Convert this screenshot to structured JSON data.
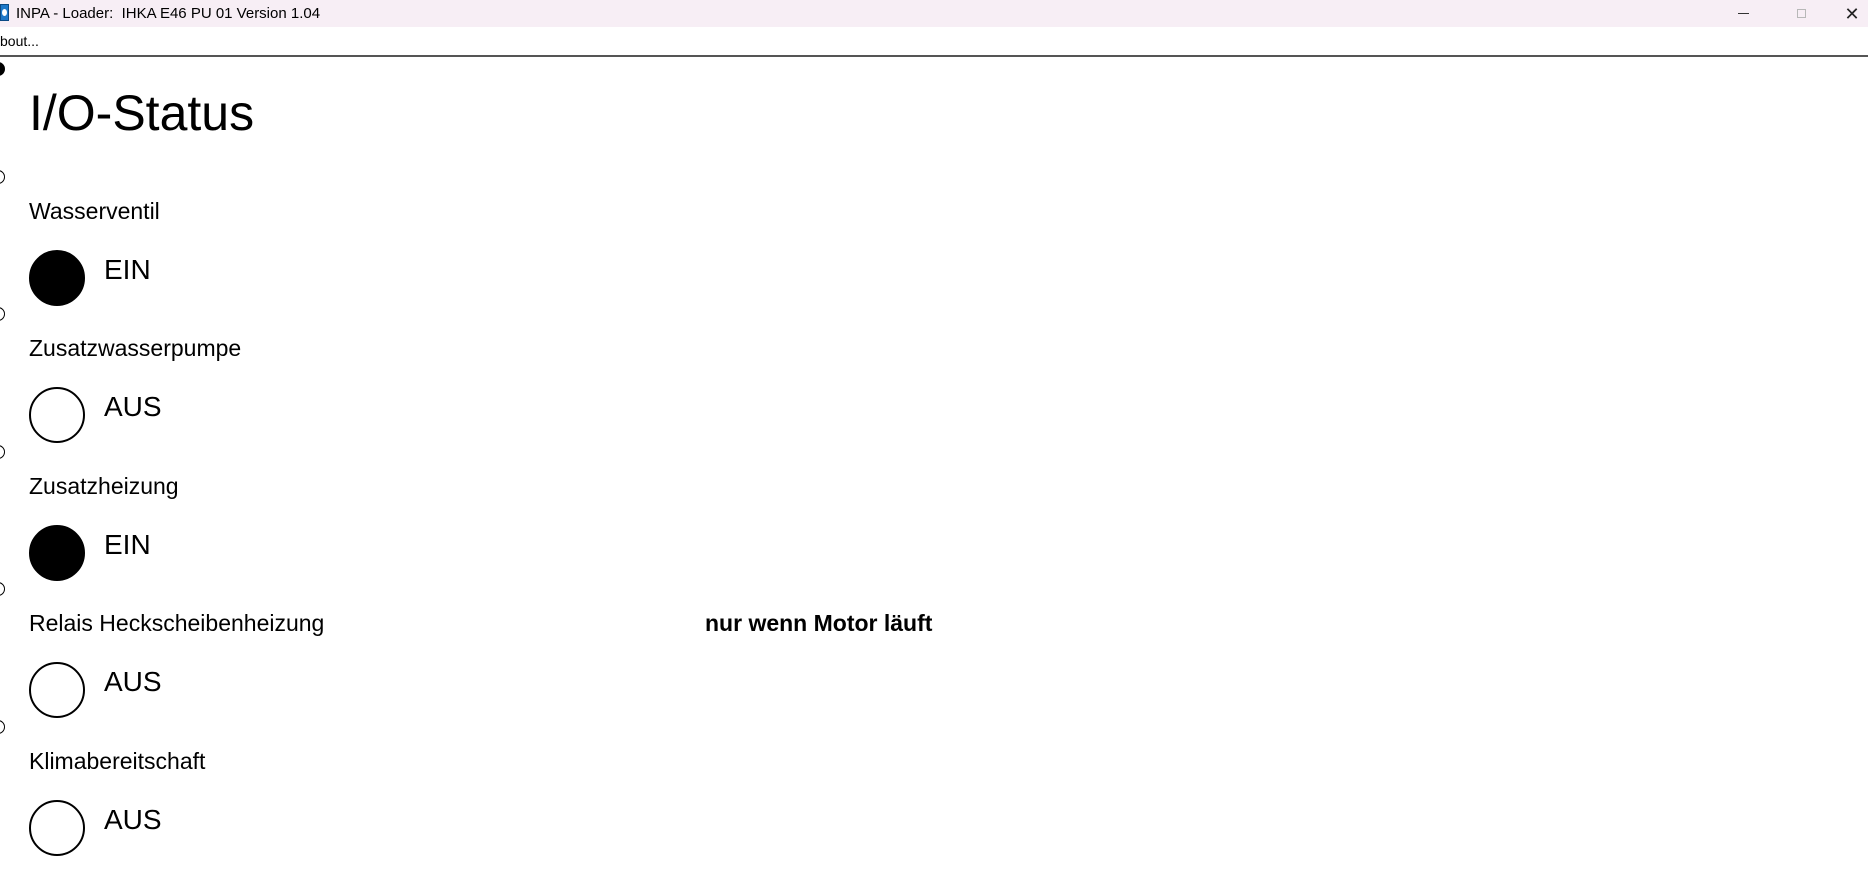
{
  "window": {
    "title": "INPA - Loader:  IHKA E46 PU 01 Version 1.04",
    "minimize_icon": "minimize-icon",
    "maximize_icon": "maximize-icon",
    "close_icon": "close-icon",
    "close_glyph": "✕"
  },
  "menu": {
    "about": "bout..."
  },
  "page": {
    "title": "I/O-Status"
  },
  "screen_selector": {
    "selected_index": 0,
    "count": 6
  },
  "io_items": [
    {
      "label": "Wasserventil",
      "state": "on",
      "value": "EIN",
      "note": ""
    },
    {
      "label": "Zusatzwasserpumpe",
      "state": "off",
      "value": "AUS",
      "note": ""
    },
    {
      "label": "Zusatzheizung",
      "state": "on",
      "value": "EIN",
      "note": ""
    },
    {
      "label": "Relais Heckscheibenheizung",
      "state": "off",
      "value": "AUS",
      "note": "nur wenn Motor läuft"
    },
    {
      "label": "Klimabereitschaft",
      "state": "off",
      "value": "AUS",
      "note": ""
    }
  ],
  "colors": {
    "titlebar_bg": "#f7eef5",
    "background": "#ffffff",
    "lamp_on": "#000000",
    "lamp_off": "#ffffff"
  }
}
